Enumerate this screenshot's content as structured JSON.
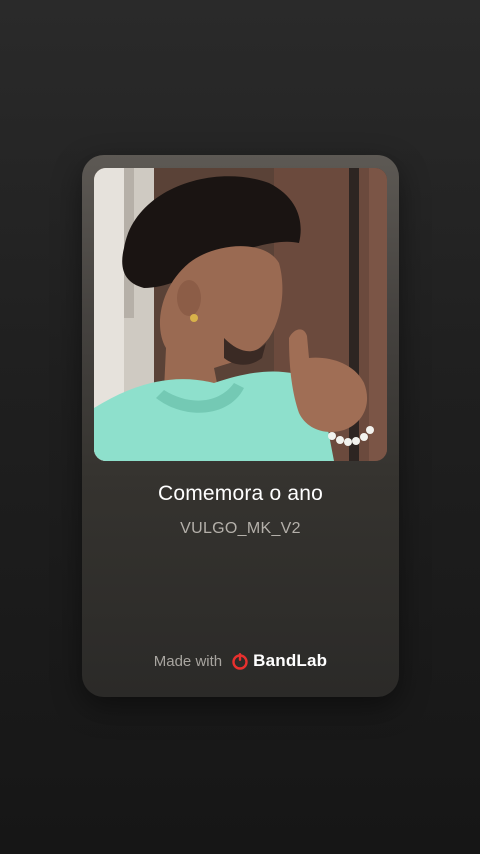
{
  "card": {
    "title": "Comemora o ano",
    "artist": "VULGO_MK_V2",
    "cover_image": "profile-photo"
  },
  "footer": {
    "made_with": "Made with",
    "brand_name": "BandLab",
    "brand_icon": "bandlab-logo-icon",
    "brand_color": "#e8302e"
  },
  "colors": {
    "background": "#1f1f1f",
    "card_top": "#5d5954",
    "card_bottom": "#2b2a28",
    "title": "#ffffff",
    "artist": "#b4b0aa"
  }
}
